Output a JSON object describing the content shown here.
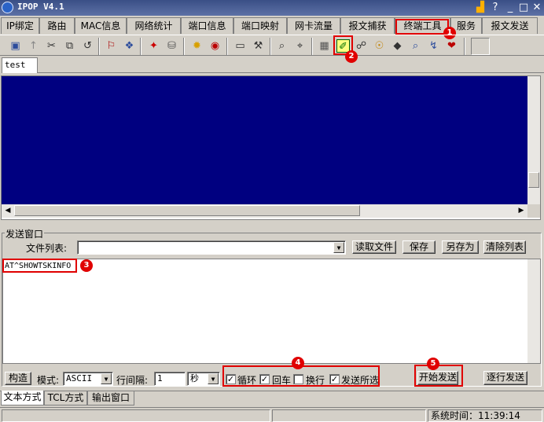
{
  "window": {
    "title": "IPOP V4.1",
    "controls": [
      "▟",
      "?",
      "_",
      "□",
      "✕"
    ]
  },
  "tabs": [
    "IP绑定",
    "路由",
    "MAC信息",
    "网络统计",
    "端口信息",
    "端口映射",
    "网卡流量",
    "报文捕获",
    "终端工具",
    "服务",
    "报文发送"
  ],
  "toolbar_icons": [
    "▣",
    "↑",
    "✂",
    "⧉",
    "↺",
    "⚐",
    "❖",
    "✦",
    "⛁",
    "✹",
    "◉",
    "▭",
    "⚒",
    "⌕",
    "⌖",
    "▦",
    "✐",
    "☍",
    "☉",
    "◆",
    "⌕",
    "↯",
    "❤"
  ],
  "doc_tab": "test",
  "send_window": {
    "legend": "发送窗口",
    "file_list_label": "文件列表:",
    "file_list_value": "",
    "read_file": "读取文件",
    "save": "保存",
    "save_as": "另存为",
    "clear_list": "清除列表",
    "command_text": "AT^SHOWTSKINFO",
    "build": "构造",
    "mode_label": "模式:",
    "mode_value": "ASCII",
    "interval_label": "行间隔:",
    "interval_value": "1",
    "unit_value": "秒",
    "loop": "循环",
    "cr": "回车",
    "lf": "换行",
    "send_selected": "发送所选",
    "start_send": "开始发送",
    "line_send": "逐行发送",
    "loop_checked": "✓",
    "cr_checked": "✓",
    "lf_checked": "",
    "send_selected_checked": "✓"
  },
  "bottom_tabs": [
    "文本方式",
    "TCL方式",
    "输出窗口"
  ],
  "status": {
    "time_label": "系统时间：",
    "time_value": "11:39:14"
  },
  "annotations": [
    "1",
    "2",
    "3",
    "4",
    "5"
  ]
}
